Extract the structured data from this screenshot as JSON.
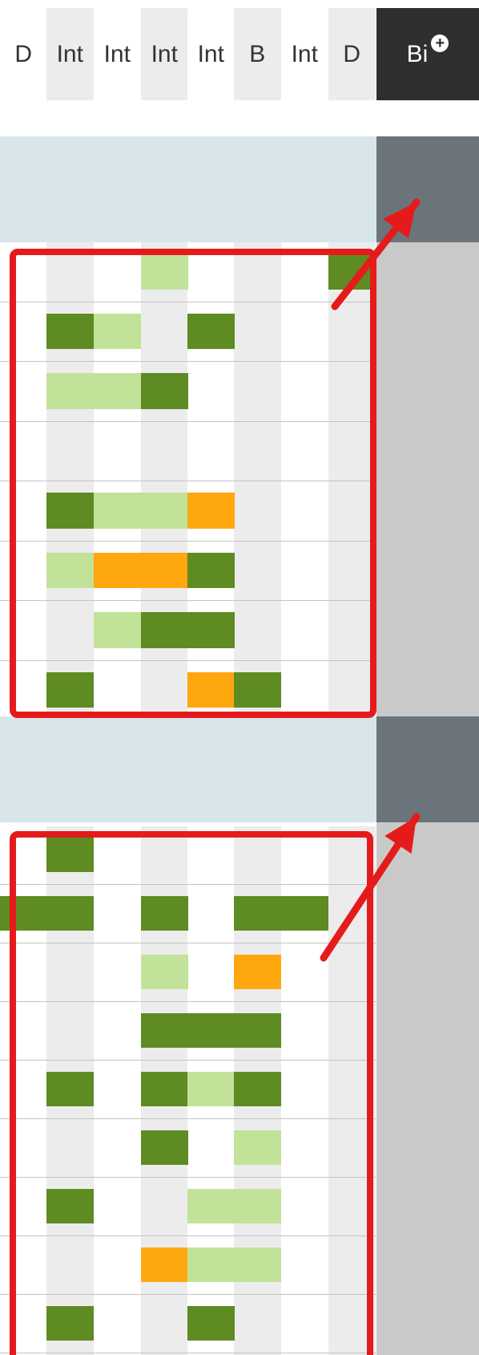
{
  "header": {
    "columns": [
      "D",
      "Int",
      "Int",
      "Int",
      "Int",
      "B",
      "Int",
      "D"
    ],
    "add_column_label": "Bi",
    "add_icon": "plus-circle-icon"
  },
  "help_buttons": [
    "?",
    "?"
  ],
  "colors": {
    "dark_green": "#5e8b22",
    "light_green": "#c2e29a",
    "orange": "#ffa70f",
    "band_blue": "#d8e6ec",
    "annotation_red": "#e51b1b",
    "header_dark": "#2f2f2f",
    "side_gray": "#c9c9c9",
    "side_band_gray": "#6b747a"
  },
  "groups": [
    {
      "rows": [
        [
          "",
          "",
          "",
          "L",
          "",
          "",
          "",
          "D"
        ],
        [
          "",
          "D",
          "L",
          "",
          "D",
          "",
          "",
          ""
        ],
        [
          "",
          "L",
          "L",
          "D",
          "",
          "",
          "",
          ""
        ],
        [
          "",
          "",
          "",
          "",
          "",
          "",
          "",
          ""
        ],
        [
          "",
          "D",
          "L",
          "L",
          "O",
          "",
          "",
          ""
        ],
        [
          "",
          "L",
          "O",
          "O",
          "D",
          "",
          "",
          ""
        ],
        [
          "",
          "",
          "L",
          "D",
          "D",
          "",
          "",
          ""
        ],
        [
          "",
          "D",
          "",
          "",
          "O",
          "D",
          "",
          ""
        ]
      ]
    },
    {
      "rows": [
        [
          "",
          "D",
          "",
          "",
          "",
          "",
          "",
          ""
        ],
        [
          "D",
          "D",
          "",
          "D",
          "",
          "D",
          "D",
          ""
        ],
        [
          "",
          "",
          "",
          "L",
          "",
          "O",
          "",
          ""
        ],
        [
          "",
          "",
          "",
          "D",
          "D",
          "D",
          "",
          ""
        ],
        [
          "",
          "D",
          "",
          "D",
          "L",
          "D",
          "",
          ""
        ],
        [
          "",
          "",
          "",
          "D",
          "",
          "L",
          "",
          ""
        ],
        [
          "",
          "D",
          "",
          "",
          "L",
          "L",
          "",
          ""
        ],
        [
          "",
          "",
          "",
          "O",
          "L",
          "L",
          "",
          ""
        ],
        [
          "",
          "D",
          "",
          "",
          "D",
          "",
          "",
          ""
        ]
      ]
    }
  ]
}
